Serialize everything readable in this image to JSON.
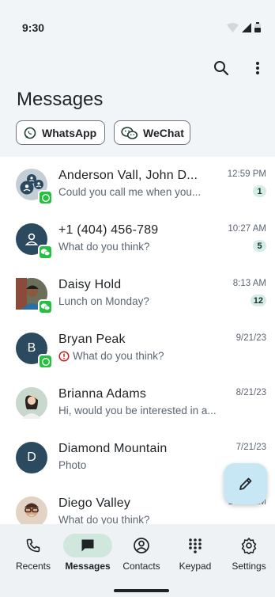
{
  "status_bar": {
    "time": "9:30"
  },
  "header": {
    "title": "Messages"
  },
  "filters": [
    {
      "label": "WhatsApp",
      "icon": "whatsapp-icon"
    },
    {
      "label": "WeChat",
      "icon": "wechat-icon"
    }
  ],
  "conversations": [
    {
      "name": "Anderson Vall, John D...",
      "snippet": "Could you call me when you...",
      "time": "12:59 PM",
      "unread": "1",
      "app": "whatsapp",
      "avatar": "group"
    },
    {
      "name": "+1 (404) 456-789",
      "snippet": "What do you think?",
      "time": "10:27 AM",
      "unread": "5",
      "app": "wechat",
      "avatar": "person"
    },
    {
      "name": "Daisy Hold",
      "snippet": "Lunch on Monday?",
      "time": "8:13 AM",
      "unread": "12",
      "app": "wechat",
      "avatar": "photo"
    },
    {
      "name": "Bryan Peak",
      "snippet": "What do you think?",
      "time": "9/21/23",
      "unread": "",
      "app": "whatsapp",
      "avatar": "B",
      "error": true
    },
    {
      "name": "Brianna Adams",
      "snippet": "Hi, would you be interested in a...",
      "time": "8/21/23",
      "unread": "",
      "app": "",
      "avatar": "photo"
    },
    {
      "name": "Diamond Mountain",
      "snippet": "Photo",
      "time": "7/21/23",
      "unread": "",
      "app": "",
      "avatar": "D"
    },
    {
      "name": "Diego Valley",
      "snippet": "What do you think?",
      "time": "10:27 AM",
      "unread": "",
      "app": "",
      "avatar": "photo"
    }
  ],
  "nav": [
    {
      "label": "Recents",
      "icon": "phone-icon"
    },
    {
      "label": "Messages",
      "icon": "message-icon",
      "active": true
    },
    {
      "label": "Contacts",
      "icon": "contacts-icon"
    },
    {
      "label": "Keypad",
      "icon": "keypad-icon"
    },
    {
      "label": "Settings",
      "icon": "settings-icon"
    }
  ],
  "colors": {
    "accent_green": "#25c03f",
    "avatar_bg": "#2c4a5f",
    "fab_bg": "#c7e7f5",
    "active_nav_bg": "#cfe7dd",
    "unread_badge_bg": "#d6ece6",
    "error_red": "#c5221f"
  }
}
